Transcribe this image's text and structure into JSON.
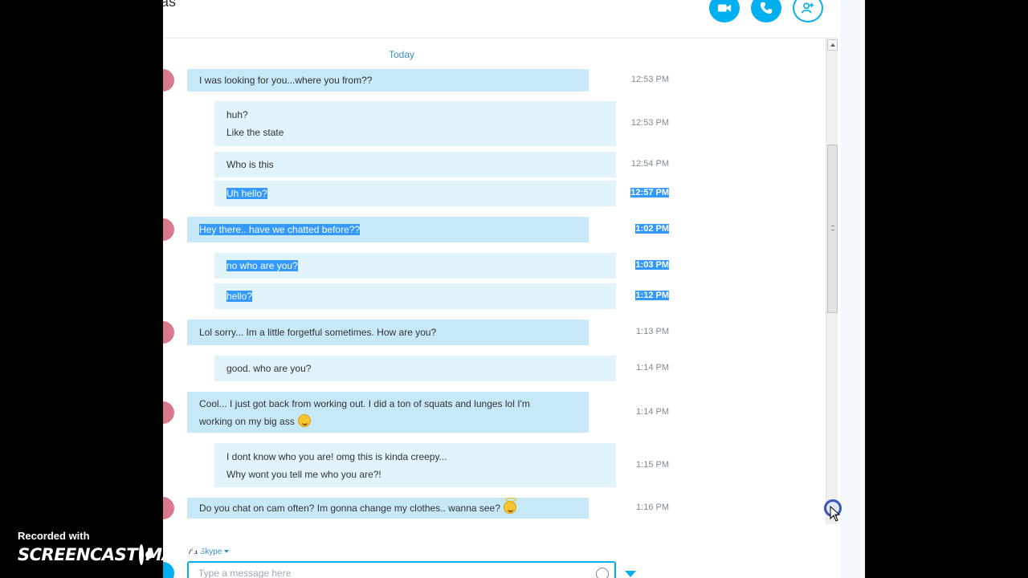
{
  "header": {
    "title": "as",
    "video_call_icon": "video-camera-icon",
    "audio_call_icon": "phone-icon",
    "add_people_icon": "add-person-icon"
  },
  "chat": {
    "date_separator": "Today",
    "messages": [
      {
        "direction": "in",
        "lines": [
          "I was looking for you...where you from??"
        ],
        "time": "12:53 PM",
        "selected": false
      },
      {
        "direction": "out",
        "lines": [
          "huh?",
          "Like the state"
        ],
        "time": "12:53 PM",
        "selected": false
      },
      {
        "direction": "out",
        "lines": [
          "Who is this"
        ],
        "time": "12:54 PM",
        "selected": false
      },
      {
        "direction": "out",
        "lines": [
          "Uh hello?"
        ],
        "time": "12:57 PM",
        "selected": true
      },
      {
        "direction": "in",
        "lines": [
          "Hey there.. have we chatted before??"
        ],
        "time": "1:02 PM",
        "selected": true
      },
      {
        "direction": "out",
        "lines": [
          "no who are you?"
        ],
        "time": "1:03 PM",
        "selected": true
      },
      {
        "direction": "out",
        "lines": [
          "hello?"
        ],
        "time": "1:12 PM",
        "selected": true
      },
      {
        "direction": "in",
        "lines": [
          "Lol sorry... Im a little forgetful sometimes. How are you?"
        ],
        "time": "1:13 PM",
        "selected": false
      },
      {
        "direction": "out",
        "lines": [
          "good. who are you?"
        ],
        "time": "1:14 PM",
        "selected": false
      },
      {
        "direction": "in",
        "lines": [
          "Cool... I just got back from working out. I did a ton of squats and lunges lol I'm",
          "working on my big ass"
        ],
        "time": "1:14 PM",
        "selected": false
      },
      {
        "direction": "out",
        "lines": [
          "I dont know who you are! omg this is kinda creepy...",
          "Why wont you tell me who you are?!"
        ],
        "time": "1:15 PM",
        "selected": false
      },
      {
        "direction": "in",
        "lines": [
          "Do you chat on cam often? Im gonna change my clothes.. wanna see?"
        ],
        "time": "1:16 PM",
        "selected": false
      }
    ]
  },
  "compose": {
    "via_label": "via",
    "via_service": "Skype",
    "placeholder": "Type a message here"
  },
  "watermark": {
    "line1": "Recorded with",
    "line2_a": "SCREENCAST",
    "line2_b": "MATIC"
  },
  "colors": {
    "accent": "#00aff0",
    "incoming_bubble": "#c7e8f7",
    "outgoing_bubble": "#e1f3fb",
    "selection": "#3399ff"
  }
}
